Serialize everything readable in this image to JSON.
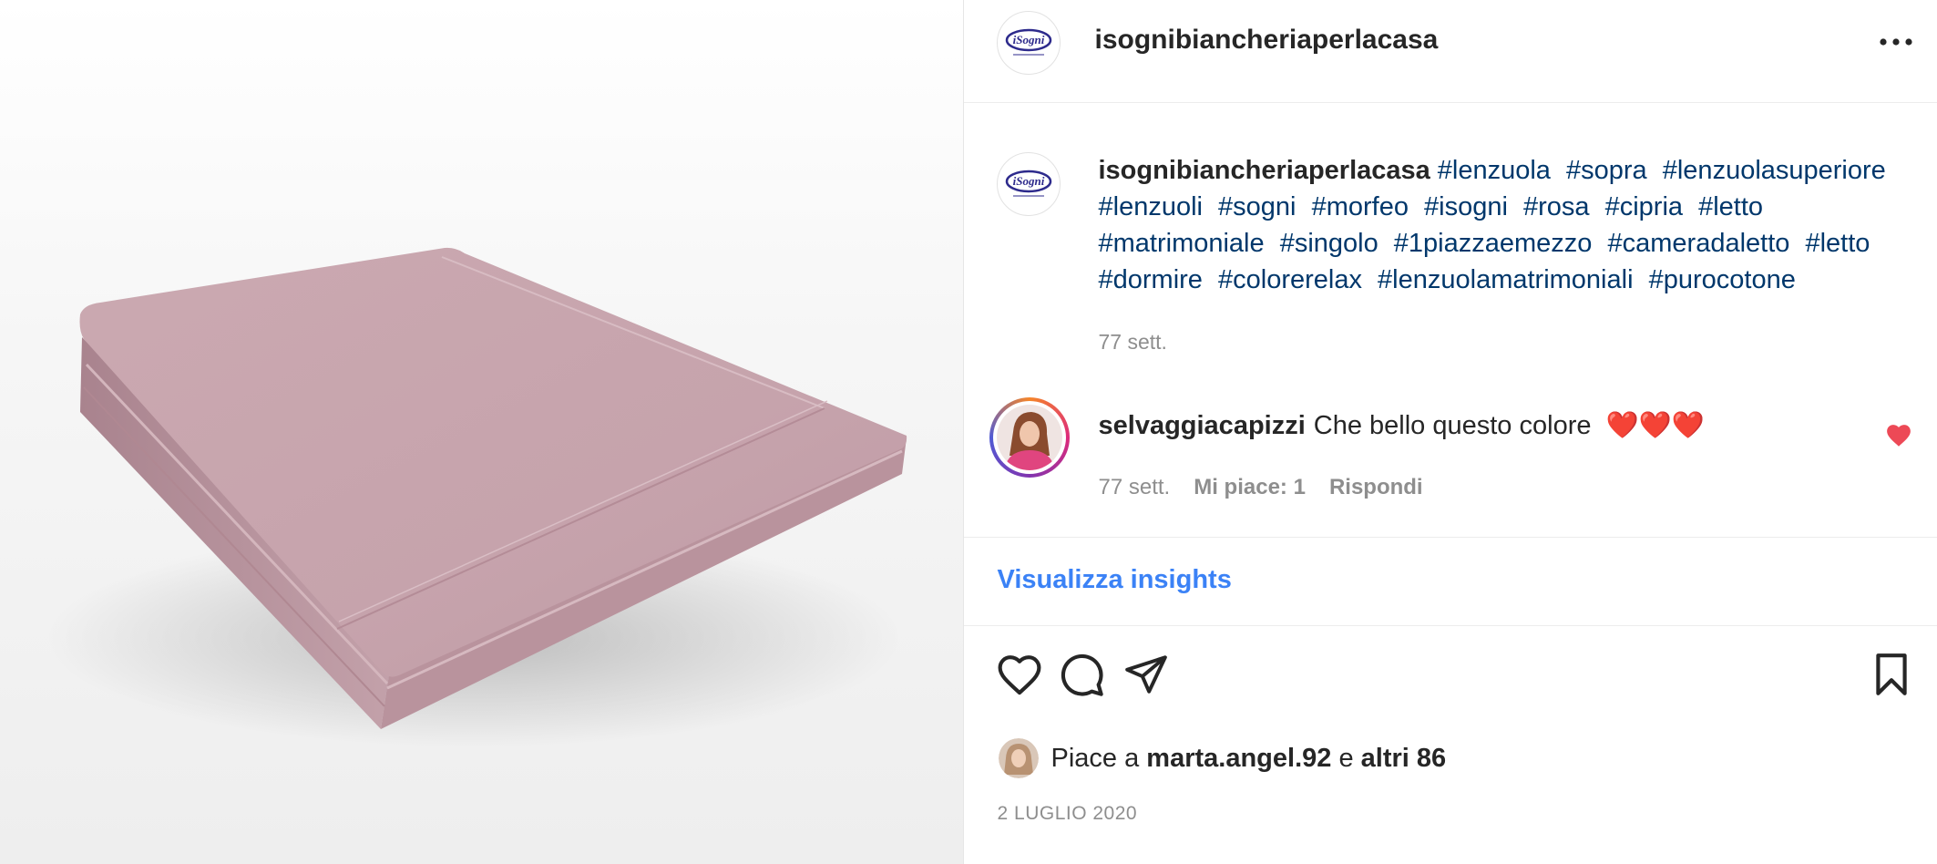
{
  "post": {
    "username": "isognibiancheriaperlacasa",
    "logo_text": "iSogni"
  },
  "caption": {
    "author": "isognibiancheriaperlacasa",
    "hashtags": [
      "#lenzuola",
      "#sopra",
      "#lenzuolasuperiore",
      "#lenzuoli",
      "#sogni",
      "#morfeo",
      "#isogni",
      "#rosa",
      "#cipria",
      "#letto",
      "#matrimoniale",
      "#singolo",
      "#1piazzaemezzo",
      "#cameradaletto",
      "#letto",
      "#dormire",
      "#colorerelax",
      "#lenzuolamatrimoniali",
      "#purocotone"
    ],
    "time": "77 sett."
  },
  "comment": {
    "author": "selvaggiacapizzi",
    "text": "Che bello questo colore",
    "emoji": "❤️❤️❤️",
    "time": "77 sett.",
    "likes_label": "Mi piace: 1",
    "reply_label": "Rispondi"
  },
  "insights": {
    "label": "Visualizza insights"
  },
  "likes": {
    "prefix": "Piace a ",
    "user": "marta.angel.92",
    "middle": " e ",
    "others": "altri 86"
  },
  "date": "2 LUGLIO 2020",
  "icons": {
    "more": "more-horizontal-icon",
    "like": "heart-outline-icon",
    "comment": "comment-bubble-icon",
    "share": "paper-plane-icon",
    "save": "bookmark-icon",
    "comment_like": "heart-filled-icon"
  },
  "colors": {
    "hashtag": "#00376b",
    "link": "#3b82f6",
    "muted": "#8e8e8e",
    "heart": "#ed4956",
    "sheet": "#c9a7af"
  }
}
